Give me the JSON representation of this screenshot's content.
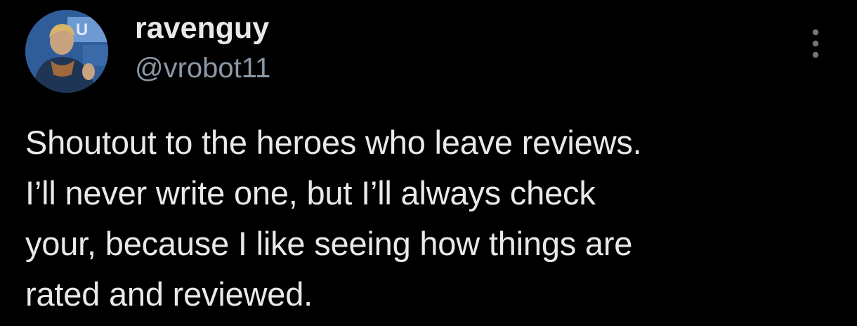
{
  "tweet": {
    "display_name": "ravenguy",
    "handle": "@vrobot11",
    "text": "Shoutout to the heroes who leave reviews.\nI’ll never write one, but I’ll always check\nyour, because I like seeing how things are\nrated and reviewed.",
    "avatar_icon": "profile-photo",
    "more_icon": "more-vertical-icon"
  },
  "colors": {
    "background": "#000000",
    "text_primary": "#e7e9ea",
    "text_secondary": "#8b98a5"
  }
}
